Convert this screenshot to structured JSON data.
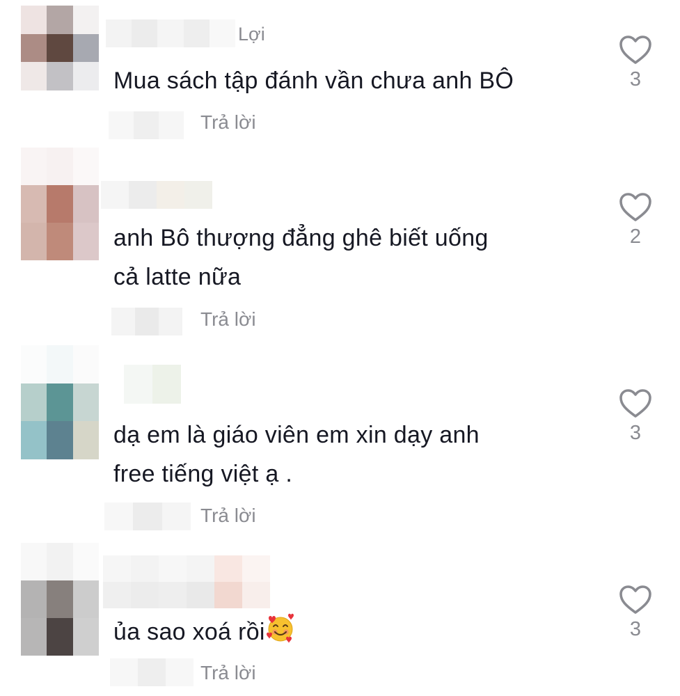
{
  "comments": [
    {
      "name_suffix": "Lợi",
      "text_lines": [
        "Mua sách tập đánh vần chưa anh BÔ"
      ],
      "reply_label": "Trả lời",
      "like_count": "3",
      "avatar_colors": [
        "#eee3e2",
        "#b3a6a5",
        "#f3f1f1",
        "#ac8c85",
        "#5f4840",
        "#a7a9b1",
        "#efe8e7",
        "#c2c1c5",
        "#ececee"
      ]
    },
    {
      "name_suffix": "",
      "text_lines": [
        "anh Bô thượng đẳng ghê biết uống",
        "cả latte nữa"
      ],
      "reply_label": "Trả lời",
      "like_count": "2",
      "avatar_colors": [
        "#f9f4f4",
        "#f7f1f1",
        "#fbf8f8",
        "#d7bab2",
        "#b77a6b",
        "#d7c2c3",
        "#d3b5ac",
        "#bf8a7a",
        "#dcc8c9"
      ]
    },
    {
      "name_suffix": "",
      "text_lines": [
        "dạ em là giáo viên em xin dạy anh",
        "free tiếng việt ạ ."
      ],
      "reply_label": "Trả lời",
      "like_count": "3",
      "avatar_colors": [
        "#fbfcfc",
        "#f3f8f9",
        "#fbfbfb",
        "#b6cfcb",
        "#5c9595",
        "#c7d6d2",
        "#94c2c8",
        "#5d8290",
        "#d6d6c8"
      ]
    },
    {
      "name_suffix": "",
      "text_lines": [
        "ủa sao xoá rồi"
      ],
      "reply_label": "Trả lời",
      "like_count": "3",
      "avatar_colors": [
        "#f8f8f8",
        "#f2f2f2",
        "#fafafa",
        "#b4b3b3",
        "#87807d",
        "#cccccc",
        "#b7b6b6",
        "#4c4443",
        "#cfcfcf"
      ]
    }
  ],
  "emoji_name": "smiling-face-with-hearts",
  "colors": {
    "text": "#161823",
    "secondary": "#8a8b91",
    "heart_stroke": "#8a8b91"
  }
}
